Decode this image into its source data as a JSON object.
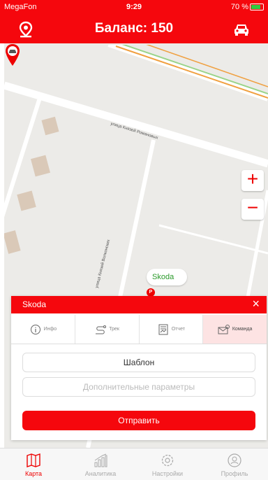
{
  "status_bar": {
    "carrier": "MegaFon",
    "time": "9:29",
    "battery": "70 %"
  },
  "header": {
    "title": "Баланс: 150",
    "left_icon": "location-pin-icon",
    "right_icon": "car-icon"
  },
  "map": {
    "street_1": "улица Князей Романовых",
    "street_2": "улица Князей Волконских",
    "zoom_in_label": "+",
    "zoom_out_label": "−",
    "vehicle_label": "Skoda",
    "parking_badge": "P"
  },
  "panel": {
    "title": "Skoda",
    "close_label": "×",
    "tabs": [
      {
        "label": "Инфо",
        "icon": "info-icon"
      },
      {
        "label": "Трек",
        "icon": "track-icon"
      },
      {
        "label": "Отчет",
        "icon": "report-icon"
      },
      {
        "label": "Команда",
        "icon": "command-icon"
      }
    ],
    "active_tab": 3,
    "template_button": "Шаблон",
    "params_placeholder": "Дополнительные параметры",
    "send_button": "Отправить"
  },
  "tabbar": {
    "items": [
      {
        "label": "Карта",
        "icon": "map-icon"
      },
      {
        "label": "Аналитика",
        "icon": "analytics-icon"
      },
      {
        "label": "Настройки",
        "icon": "settings-icon"
      },
      {
        "label": "Профиль",
        "icon": "profile-icon"
      }
    ],
    "active": 0
  },
  "colors": {
    "brand": "#f5070d",
    "green_label": "#2a9a2a"
  }
}
